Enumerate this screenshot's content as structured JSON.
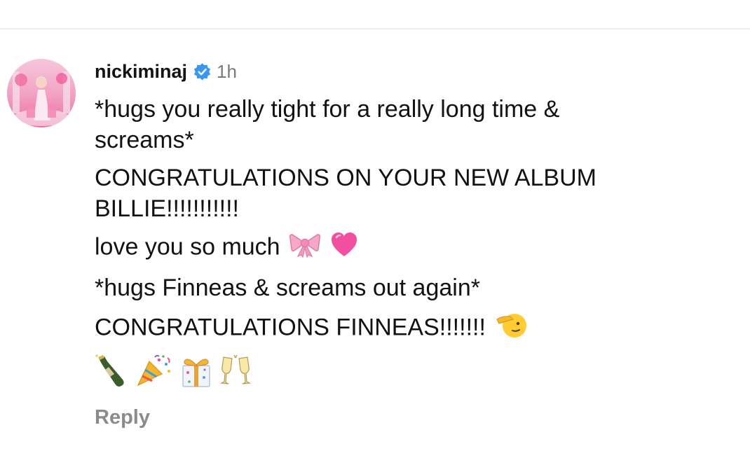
{
  "comment": {
    "username": "nickiminaj",
    "verified_icon": "verified-badge-icon",
    "timestamp": "1h",
    "lines": [
      "*hugs you really tight for a really long time &",
      "screams*",
      "CONGRATULATIONS ON YOUR NEW ALBUM",
      "BILLIE!!!!!!!!!!!",
      "love you so much",
      "*hugs Finneas & screams out again*",
      "CONGRATULATIONS FINNEAS!!!!!!!"
    ],
    "emoji_line_love": [
      "ribbon-bow-emoji",
      "pink-heart-emoji"
    ],
    "emoji_line_finneas": [
      "saluting-face-emoji"
    ],
    "emoji_row": [
      "champagne-bottle-emoji",
      "party-popper-emoji",
      "wrapped-gift-emoji",
      "clinking-glasses-emoji"
    ],
    "reply_label": "Reply"
  },
  "colors": {
    "verified_blue": "#3897f0",
    "muted_text": "#8b8b8b",
    "timestamp_gray": "#7a7a7a"
  }
}
